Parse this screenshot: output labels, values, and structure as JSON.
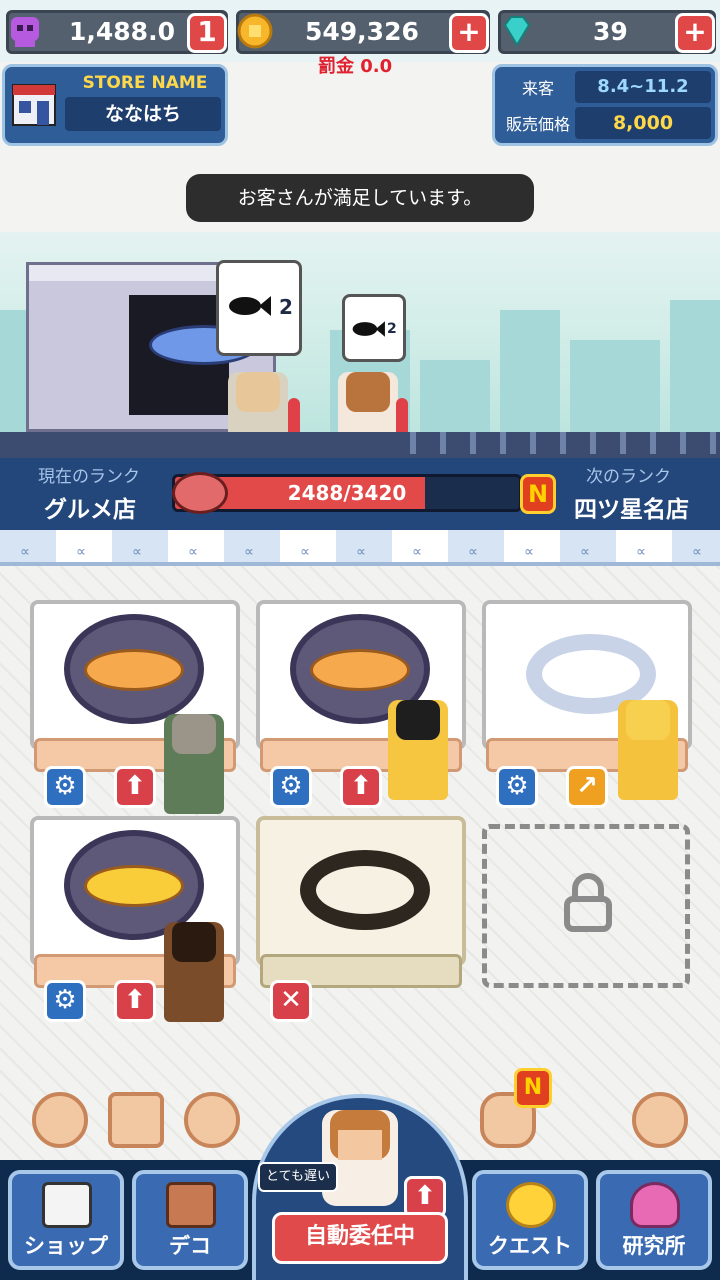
{
  "topbar": {
    "energy": "1,488.0",
    "energy_badge": "1",
    "coins": "549,326",
    "gems": "39",
    "plus": "+",
    "penalty": "罰金 0.0"
  },
  "store": {
    "name_label": "STORE NAME",
    "name": "ななはち",
    "visitors_label": "来客",
    "visitors": "8.4~11.2",
    "price_label": "販売価格",
    "price": "8,000"
  },
  "toast": "お客さんが満足しています。",
  "scene": {
    "order1_count": "2",
    "order2_count": "2"
  },
  "rank": {
    "current_label": "現在のランク",
    "current": "グルメ店",
    "progress_text": "2488/3420",
    "progress": 0.7275,
    "next_badge": "N",
    "next_label": "次のランク",
    "next": "四ツ星名店"
  },
  "tools": {
    "notify_badge": "N"
  },
  "nav": {
    "shop": "ショップ",
    "deco": "デコ",
    "speed": "とても遅い",
    "auto": "自動委任中",
    "quest": "クエスト",
    "lab": "研究所"
  },
  "colors": {
    "accent_blue": "#24477b",
    "accent_red": "#e04a4a",
    "gold": "#ffd84a"
  }
}
